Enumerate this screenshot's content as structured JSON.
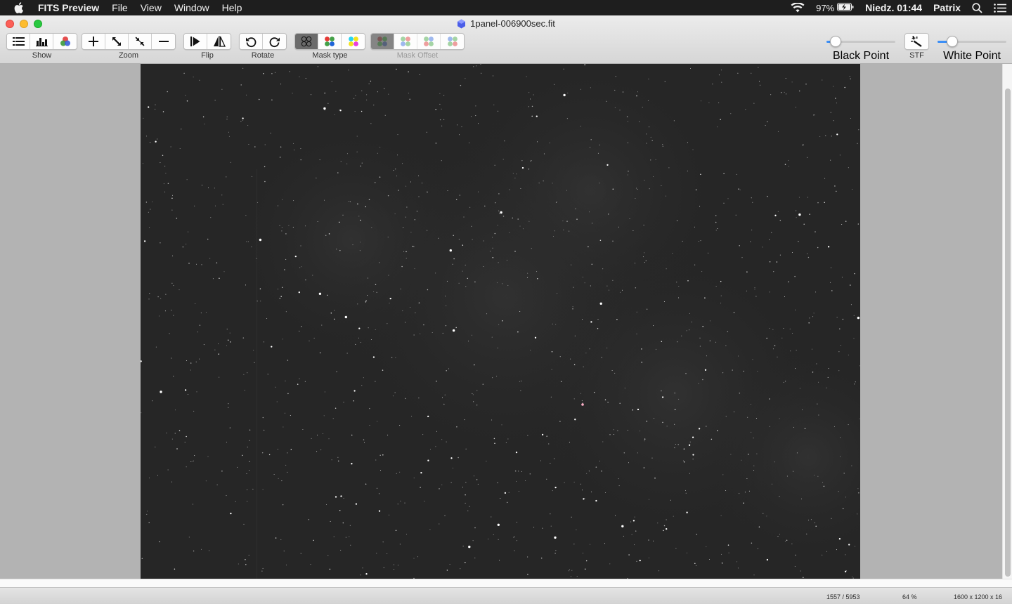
{
  "menubar": {
    "app_name": "FITS Preview",
    "items": [
      "File",
      "View",
      "Window",
      "Help"
    ],
    "battery": "97%",
    "clock": "Niedz. 01:44",
    "user": "Patrix"
  },
  "window": {
    "title": "1panel-006900sec.fit"
  },
  "toolbar": {
    "show_label": "Show",
    "zoom_label": "Zoom",
    "flip_label": "Flip",
    "rotate_label": "Rotate",
    "mask_type_label": "Mask type",
    "mask_offset_label": "Mask Offset",
    "black_point_label": "Black Point",
    "stf_label": "STF",
    "white_point_label": "White Point",
    "black_point_value": 0.06,
    "white_point_value": 0.16
  },
  "colors": {
    "accent": "#3b8ff7",
    "image_background": "#262626",
    "window_background": "#b3b3b3"
  },
  "status": {
    "frame_counter": "1557 / 5953",
    "zoom": "64 %",
    "dimensions": "1600 x 1200 x 16"
  }
}
